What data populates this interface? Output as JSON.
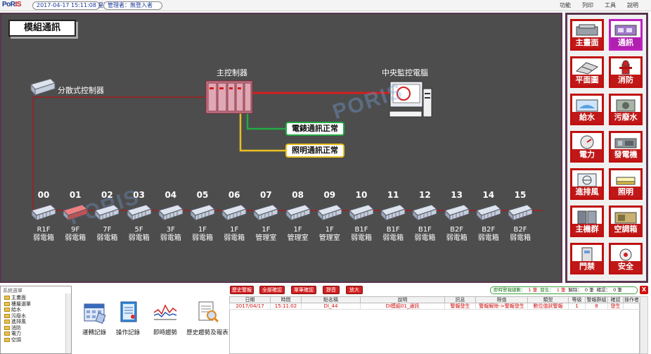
{
  "topbar": {
    "logo_main": "PoR",
    "logo_accent": "IS",
    "datetime": "2017-04-17 15:11:08 星期一",
    "user": "管理者：無登入者",
    "menu": [
      "功能",
      "列印",
      "工具",
      "說明"
    ]
  },
  "main": {
    "title": "模組通訊",
    "watermark": "PORIS",
    "distributed_label": "分散式控制器",
    "main_controller_label": "主控制器",
    "central_pc_label": "中央監控電腦",
    "meter_status": "電錶通訊正常",
    "lighting_status": "照明通訊正常",
    "colors": {
      "red_line": "#d42020",
      "green_line": "#22aa44",
      "yellow_line": "#e8c020",
      "brown_line": "#8b2a2a"
    },
    "nodes": [
      {
        "num": "00",
        "floor": "R1F",
        "room": "弱電箱",
        "alarm": false
      },
      {
        "num": "01",
        "floor": "9F",
        "room": "弱電箱",
        "alarm": true
      },
      {
        "num": "02",
        "floor": "7F",
        "room": "弱電箱",
        "alarm": false
      },
      {
        "num": "03",
        "floor": "5F",
        "room": "弱電箱",
        "alarm": false
      },
      {
        "num": "04",
        "floor": "3F",
        "room": "弱電箱",
        "alarm": false
      },
      {
        "num": "05",
        "floor": "1F",
        "room": "弱電箱",
        "alarm": false
      },
      {
        "num": "06",
        "floor": "1F",
        "room": "弱電箱",
        "alarm": false
      },
      {
        "num": "07",
        "floor": "1F",
        "room": "管理室",
        "alarm": false
      },
      {
        "num": "08",
        "floor": "1F",
        "room": "管理室",
        "alarm": false
      },
      {
        "num": "09",
        "floor": "1F",
        "room": "管理室",
        "alarm": false
      },
      {
        "num": "10",
        "floor": "B1F",
        "room": "弱電箱",
        "alarm": false
      },
      {
        "num": "11",
        "floor": "B1F",
        "room": "弱電箱",
        "alarm": false
      },
      {
        "num": "12",
        "floor": "B1F",
        "room": "弱電箱",
        "alarm": false
      },
      {
        "num": "13",
        "floor": "B2F",
        "room": "弱電箱",
        "alarm": false
      },
      {
        "num": "14",
        "floor": "B2F",
        "room": "弱電箱",
        "alarm": false
      },
      {
        "num": "15",
        "floor": "B2F",
        "room": "弱電箱",
        "alarm": false
      }
    ]
  },
  "right_menu": [
    {
      "label": "主畫面",
      "icon": "main-screen-icon",
      "active": false
    },
    {
      "label": "通訊",
      "icon": "communication-icon",
      "active": true
    },
    {
      "label": "平面圖",
      "icon": "floorplan-icon",
      "active": false
    },
    {
      "label": "消防",
      "icon": "fire-hydrant-icon",
      "active": false
    },
    {
      "label": "給水",
      "icon": "water-supply-icon",
      "active": false
    },
    {
      "label": "污廢水",
      "icon": "wastewater-icon",
      "active": false
    },
    {
      "label": "電力",
      "icon": "power-meter-icon",
      "active": false
    },
    {
      "label": "發電機",
      "icon": "generator-icon",
      "active": false
    },
    {
      "label": "進排風",
      "icon": "ventilation-icon",
      "active": false
    },
    {
      "label": "照明",
      "icon": "lighting-icon",
      "active": false
    },
    {
      "label": "主機群",
      "icon": "server-group-icon",
      "active": false
    },
    {
      "label": "空調箱",
      "icon": "air-handler-icon",
      "active": false
    },
    {
      "label": "門禁",
      "icon": "access-control-icon",
      "active": false
    },
    {
      "label": "安全",
      "icon": "security-icon",
      "active": false
    }
  ],
  "tree": {
    "title": "系統選單",
    "items": [
      "主畫面",
      "樓層選單",
      "給水",
      "污廢水",
      "進排風",
      "消防",
      "電力",
      "空調"
    ]
  },
  "tools": [
    "運轉記錄",
    "操作記錄",
    "即時趨勢",
    "歷史趨勢及報表"
  ],
  "alarm_buttons": [
    "歷史警報",
    "全部確認",
    "單筆確認",
    "靜音",
    "放大"
  ],
  "counts": {
    "realtime_label": "即時警報總數：",
    "realtime": "1 筆",
    "occur_label": "發生：",
    "occur": "1 筆",
    "clear_label": "解除：",
    "clear": "0 筆",
    "ack_label": "確認：",
    "ack": "0 筆"
  },
  "close_label": "X",
  "alarm_table": {
    "headers": [
      "日期",
      "時間",
      "點名稱",
      "說明",
      "訊息",
      "限值",
      "類型",
      "等級",
      "警報群組",
      "確認",
      "操作者"
    ],
    "rows": [
      [
        "2017/04/17",
        "15:11:02",
        "DI_44",
        "DI模組01_通訊",
        "警報發生",
        "警報解除->警報發生",
        "數位值狀警報",
        "1",
        "8",
        "發生",
        ""
      ]
    ]
  }
}
